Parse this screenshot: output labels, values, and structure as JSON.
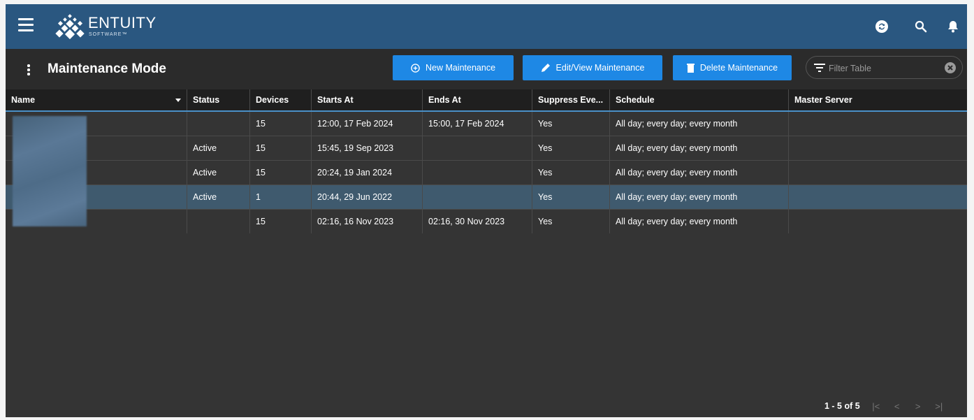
{
  "header": {
    "brand": "ENTUITY",
    "brand_sub": "SOFTWARE™"
  },
  "toolbar": {
    "title": "Maintenance Mode",
    "new_label": "New Maintenance",
    "edit_label": "Edit/View Maintenance",
    "delete_label": "Delete Maintenance",
    "filter_placeholder": "Filter Table"
  },
  "colors": {
    "topbar": "#2a5780",
    "accent": "#1e88e5",
    "selected_row": "#3f5a6e"
  },
  "table": {
    "columns": [
      "Name",
      "Status",
      "Devices",
      "Starts At",
      "Ends At",
      "Suppress Eve...",
      "Schedule",
      "Master Server"
    ],
    "rows": [
      {
        "name": "",
        "status": "",
        "devices": "15",
        "starts": "12:00, 17 Feb 2024",
        "ends": "15:00, 17 Feb 2024",
        "suppress": "Yes",
        "schedule": "All day; every day; every month",
        "master": ""
      },
      {
        "name": "",
        "status": "Active",
        "devices": "15",
        "starts": "15:45, 19 Sep 2023",
        "ends": "",
        "suppress": "Yes",
        "schedule": "All day; every day; every month",
        "master": ""
      },
      {
        "name": "",
        "status": "Active",
        "devices": "15",
        "starts": "20:24, 19 Jan 2024",
        "ends": "",
        "suppress": "Yes",
        "schedule": "All day; every day; every month",
        "master": ""
      },
      {
        "name": "",
        "status": "Active",
        "devices": "1",
        "starts": "20:44, 29 Jun 2022",
        "ends": "",
        "suppress": "Yes",
        "schedule": "All day; every day; every month",
        "master": ""
      },
      {
        "name": "",
        "status": "",
        "devices": "15",
        "starts": "02:16, 16 Nov 2023",
        "ends": "02:16, 30 Nov 2023",
        "suppress": "Yes",
        "schedule": "All day; every day; every month",
        "master": ""
      }
    ]
  },
  "pager": {
    "text": "1 - 5 of 5",
    "first": "|<",
    "prev": "<",
    "next": ">",
    "last": ">|"
  }
}
